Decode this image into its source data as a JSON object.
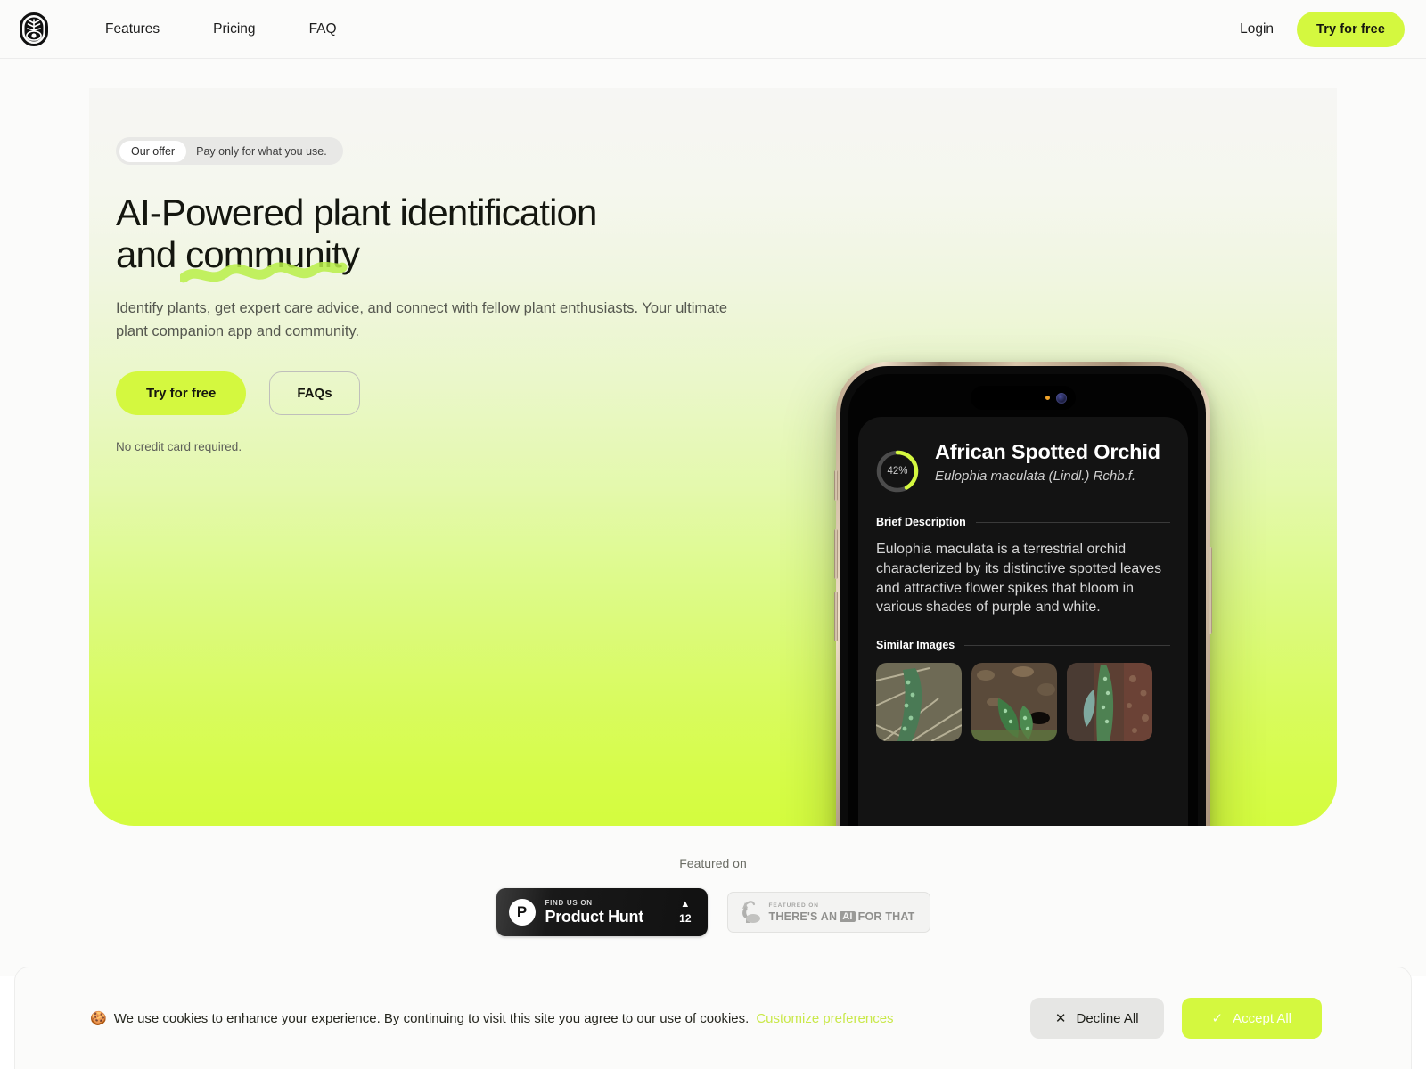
{
  "brand": {
    "logo_icon": "plant-seed-logo-icon"
  },
  "nav": {
    "links": [
      {
        "label": "Features",
        "name": "nav-link-features"
      },
      {
        "label": "Pricing",
        "name": "nav-link-pricing"
      },
      {
        "label": "FAQ",
        "name": "nav-link-faq"
      }
    ],
    "login_label": "Login",
    "cta_label": "Try for free"
  },
  "hero": {
    "badge": {
      "chip": "Our offer",
      "text": "Pay only for what you use."
    },
    "headline": {
      "line1_plain": "AI-Powered plant ",
      "line1_highlight": "identification",
      "line2_plain": "and ",
      "line2_squiggle": "community"
    },
    "subtitle": "Identify plants, get expert care advice, and connect with fellow plant enthusiasts. Your ultimate plant companion app and community.",
    "primary_cta": "Try for free",
    "secondary_cta": "FAQs",
    "note": "No credit card required.",
    "accent_color": "#d4f83f",
    "gradient_bottom": "#d4fc3e"
  },
  "phone": {
    "confidence_percent": "42%",
    "confidence_value": 42,
    "plant_name": "African Spotted Orchid",
    "scientific_name": "Eulophia maculata (Lindl.) Rchb.f.",
    "description_heading": "Brief Description",
    "description": "Eulophia maculata is a terrestrial orchid characterized by its distinctive spotted leaves and attractive flower spikes that bloom in various shades of purple and white.",
    "similar_heading": "Similar Images",
    "similar_images": [
      "orchid-thumb-1",
      "orchid-thumb-2",
      "orchid-thumb-3"
    ]
  },
  "featured": {
    "label": "Featured on",
    "product_hunt": {
      "small": "FIND US ON",
      "big": "Product Hunt",
      "caret": "▲",
      "count": "12",
      "logo_letter": "P"
    },
    "theres_an_ai": {
      "small": "FEATURED ON",
      "big_a": "THERE'S AN",
      "ai": "AI",
      "big_b": "FOR THAT"
    }
  },
  "cookie": {
    "emoji": "🍪",
    "text": "We use cookies to enhance your experience. By continuing to visit this site you agree to our use of cookies.",
    "link": "Customize preferences",
    "decline_label": "Decline All",
    "accept_label": "Accept All",
    "decline_icon": "✕",
    "accept_icon": "✓"
  }
}
